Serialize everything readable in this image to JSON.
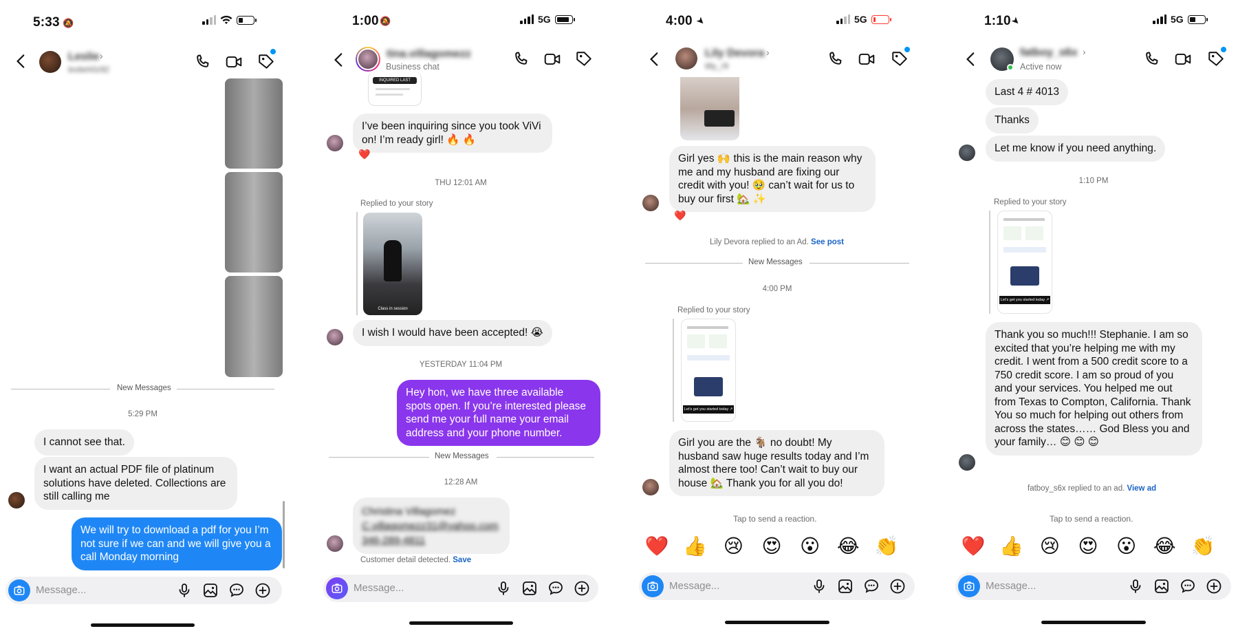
{
  "panel1": {
    "time": "5:33",
    "contact_name": "Leslie",
    "contact_sub": "leslieh0z92",
    "new_messages_label": "New Messages",
    "timestamp": "5:29 PM",
    "messages": [
      "I cannot see that.",
      "I want an actual PDF file of platinum solutions have deleted. Collections are still calling me",
      "We will try to download a pdf for you I’m not sure if we can and we will give you a call Monday morning"
    ],
    "composer_placeholder": "Message..."
  },
  "panel2": {
    "time": "1:00",
    "network": "5G",
    "contact_name": "tina.villagomezz",
    "contact_sub": "Business chat",
    "story_caption_top": "INQUIRED LAST MONTH",
    "msg_inquiring": "I’ve been inquiring since you took ViVi on! I’m ready girl! 🔥 🔥",
    "reaction1": "❤️",
    "stamp1": "THU 12:01 AM",
    "replied_label": "Replied to your story",
    "story_caption": "Class in session",
    "msg_wish": "I wish I would have been accepted! 😭",
    "stamp2": "YESTERDAY 11:04 PM",
    "msg_purple": "Hey hon, we have three available spots open. If you’re interested please send me your full name your email address and your phone number.",
    "new_messages_label": "New Messages",
    "stamp3": "12:28 AM",
    "detail_lines": [
      "Christina Villagomez",
      "C.villagomezz31@yahoo.com",
      "346-289-4811"
    ],
    "customer_detail": "Customer detail detected.",
    "save_link": "Save",
    "composer_placeholder": "Message..."
  },
  "panel3": {
    "time": "4:00",
    "network": "5G",
    "contact_name": "Lily Devora",
    "contact_sub": "lilly_r9",
    "msg_girl_yes": "Girl yes 🙌 this is the main reason why me and my husband are fixing our credit with you! 🥹 can’t wait for us to buy our first 🏡 ✨",
    "reaction1": "❤️",
    "ad_note": "Lily Devora replied to an Ad.",
    "see_post": "See post",
    "new_messages_label": "New Messages",
    "stamp1": "4:00 PM",
    "replied_label": "Replied to your story",
    "story_text": "Let’s get you started today ↗",
    "msg_goat": "Girl you are the 🐐 no doubt! My husband saw huge results today and I’m almost there too! Can’t wait to buy our house 🏡 Thank you for all you do!",
    "tap_label": "Tap to send a reaction.",
    "emojis": [
      "❤️",
      "👍",
      "😢",
      "😍",
      "😮",
      "😂",
      "👏"
    ],
    "composer_placeholder": "Message..."
  },
  "panel4": {
    "time": "1:10",
    "network": "5G",
    "contact_name": "fatboy_s6x",
    "contact_sub": "Active now",
    "msg_last4": "Last 4 # 4013",
    "msg_thanks": "Thanks",
    "msg_let_me": "Let me know if you need anything.",
    "stamp1": "1:10 PM",
    "replied_label": "Replied to your story",
    "story_text": "Let’s get you started today ↗",
    "msg_thank_you": "Thank you so much!!! Stephanie. I am so excited that you’re helping me with my credit. I went from a 500 credit score to a 750 credit score. I am so proud of you and your services. You helped me out from Texas to Compton, California. Thank\nYou so much for helping out others from across the states…… God Bless you and your family… 😊 😊 😊",
    "ad_note": "fatboy_s6x replied to an ad.",
    "view_ad": "View ad",
    "tap_label": "Tap to send a reaction.",
    "emojis": [
      "❤️",
      "👍",
      "😢",
      "😍",
      "😮",
      "😂",
      "👏"
    ],
    "composer_placeholder": "Message..."
  },
  "colors": {
    "ig_blue": "#0095f6",
    "bubble_gray": "#efeff0",
    "bubble_blue": "#1f87f5",
    "bubble_purple": "#8a36ec"
  },
  "icons": [
    "back-arrow-icon",
    "phone-icon",
    "video-icon",
    "tag-icon",
    "camera-icon",
    "microphone-icon",
    "gallery-icon",
    "sticker-icon",
    "plus-icon",
    "location-arrow-icon",
    "silent-bell-icon",
    "wifi-icon",
    "signal-icon",
    "battery-icon"
  ]
}
